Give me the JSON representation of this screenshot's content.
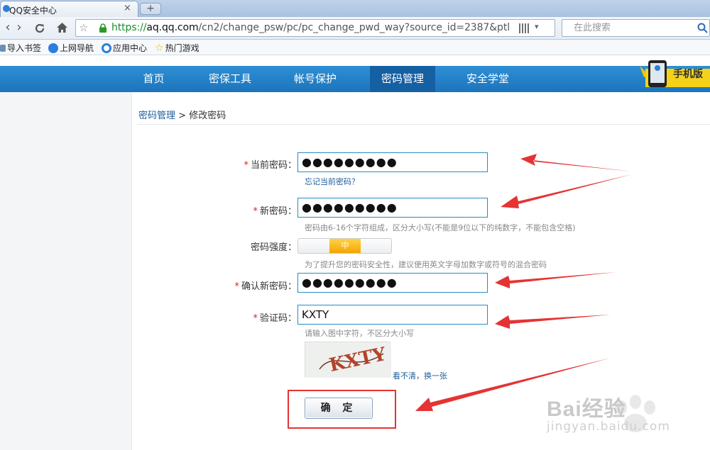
{
  "browser": {
    "tab_title": "QQ安全中心",
    "tab_close": "×",
    "new_tab": "+",
    "url_scheme": "https://",
    "url_host": "aq.qq.com",
    "url_path": "/cn2/change_psw/pc/pc_change_pwd_way?source_id=2387&ptl",
    "search_placeholder": "在此搜索",
    "bookmarks": [
      "导入书签",
      "上网导航",
      "应用中心",
      "热门游戏"
    ]
  },
  "site_nav": {
    "items": [
      "首页",
      "密保工具",
      "帐号保护",
      "密码管理",
      "安全学堂"
    ],
    "active": "密码管理",
    "mobile_label": "手机版"
  },
  "breadcrumb": {
    "parent": "密码管理",
    "separator": ">",
    "current": "修改密码"
  },
  "form": {
    "required_mark": "*",
    "current_password": {
      "label": "当前密码：",
      "value": "●●●●●●●●●",
      "link": "忘记当前密码？"
    },
    "new_password": {
      "label": "新密码：",
      "value": "●●●●●●●●●",
      "hint": "密码由6-16个字符组成，区分大小写(不能是9位以下的纯数字，不能包含空格)"
    },
    "strength": {
      "label": "密码强度：",
      "level_label": "中",
      "level": "medium",
      "hint": "为了提升您的密码安全性，建议使用英文字母加数字或符号的混合密码"
    },
    "confirm_password": {
      "label": "确认新密码：",
      "value": "●●●●●●●●●"
    },
    "captcha": {
      "label": "验证码：",
      "value": "KXTY",
      "hint": "请输入图中字符，不区分大小写",
      "captcha_image_text": "KXTY",
      "refresh_link": "看不清，换一张"
    },
    "submit_label": "确 定"
  },
  "watermark": {
    "brand": "Bai经验",
    "url": "jingyan.baidu.com"
  },
  "colors": {
    "nav_bg": "#2281c6",
    "nav_active": "#1560a3",
    "field_border": "#2a8bc0",
    "required": "#e02020",
    "annotation_red": "#e53333",
    "link": "#1d5c99"
  }
}
